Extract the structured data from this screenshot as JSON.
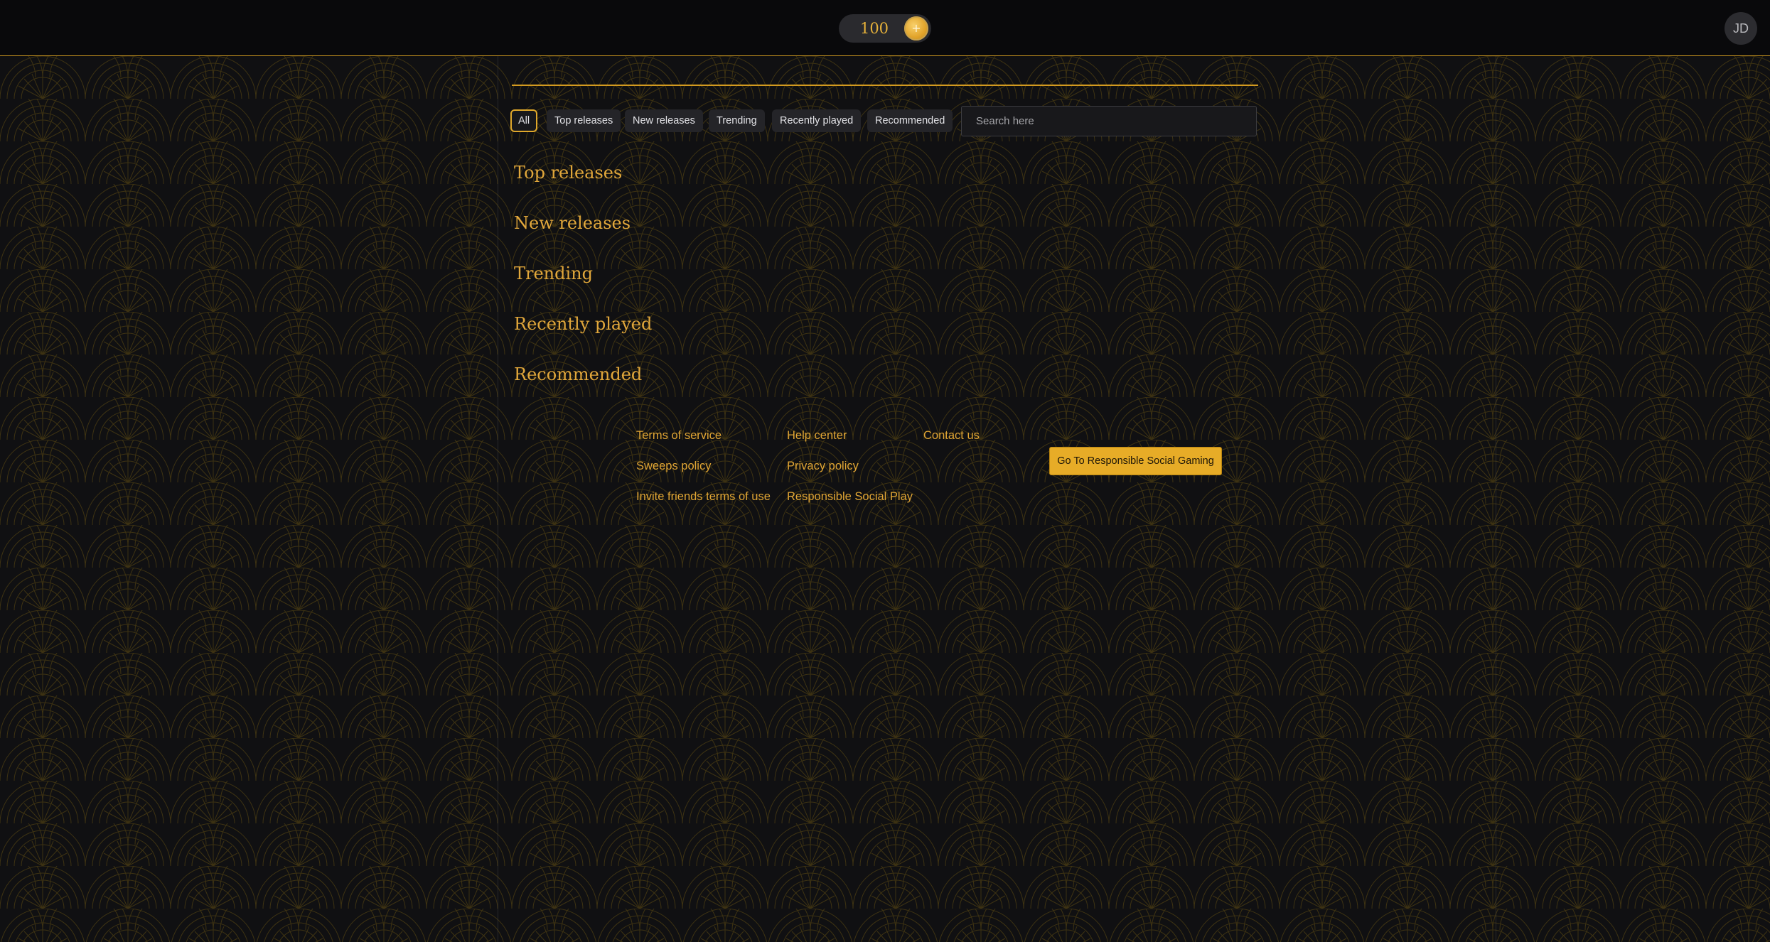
{
  "header": {
    "coin_balance": "100",
    "add_coins_label": "+",
    "avatar_initials": "JD"
  },
  "filters": {
    "chips": [
      "All",
      "Top releases",
      "New releases",
      "Trending",
      "Recently played",
      "Recommended"
    ],
    "active": "All",
    "search_placeholder": "Search here",
    "search_value": ""
  },
  "sections": [
    "Top releases",
    "New releases",
    "Trending",
    "Recently played",
    "Recommended"
  ],
  "footer": {
    "columns": [
      [
        "Terms of service",
        "Sweeps policy",
        "Invite friends terms of use"
      ],
      [
        "Help center",
        "Privacy policy",
        "Responsible Social Play"
      ],
      [
        "Contact us"
      ]
    ],
    "cta_label": "Go To Responsible Social Gaming"
  },
  "colors": {
    "accent": "#e0a534",
    "background": "#101012",
    "chip_bg": "#242428"
  },
  "icons": {
    "pattern": "art-deco-fan-pattern",
    "coin": "gold-coin-plus-icon"
  }
}
